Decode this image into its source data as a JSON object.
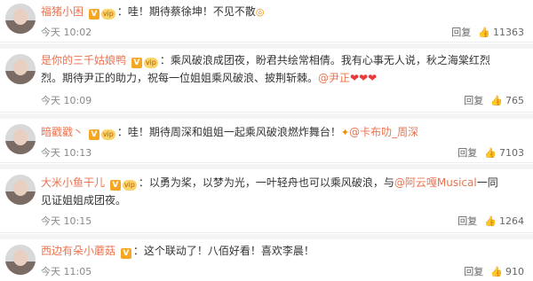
{
  "comments": [
    {
      "user": "福猪小困",
      "text": "哇！期待蔡徐坤！不见不散",
      "time": "今天 10:02",
      "reply_label": "回复",
      "likes": "11363"
    },
    {
      "user": "是你的三千姑娘鸭",
      "text_line1": "乘风破浪成团夜，盼君共绘常相倩。我有心事无人说，秋之海棠红烈",
      "text_line2": "烈。期待尹正的助力，祝每一位姐姐乘风破浪、披荆斩棘。",
      "mention": "@尹正",
      "hearts": "❤❤❤",
      "time": "今天 10:09",
      "reply_label": "回复",
      "likes": "765"
    },
    {
      "user": "暗戳戳丶",
      "text": "哇！期待周深和姐姐一起乘风破浪燃炸舞台！",
      "mention": "@卡布叻_周深",
      "time": "今天 10:13",
      "reply_label": "回复",
      "likes": "7103"
    },
    {
      "user": "大米小鱼干儿",
      "text_line1": "以勇为桨，以梦为光，一叶轻舟也可以乘风破浪，与",
      "mention": "@阿云嘎Musical",
      "text_line1b": "一同",
      "text_line2": "见证姐姐成团夜。",
      "time": "今天 10:15",
      "reply_label": "回复",
      "likes": "1264"
    },
    {
      "user": "西边有朵小蘑菇",
      "text": "这个联动了！八佰好看！喜欢李晨！",
      "time": "今天 11:05",
      "reply_label": "回复",
      "likes": "910"
    }
  ],
  "icons": {
    "verified": "V",
    "member": "vip",
    "thumb": "👍"
  }
}
